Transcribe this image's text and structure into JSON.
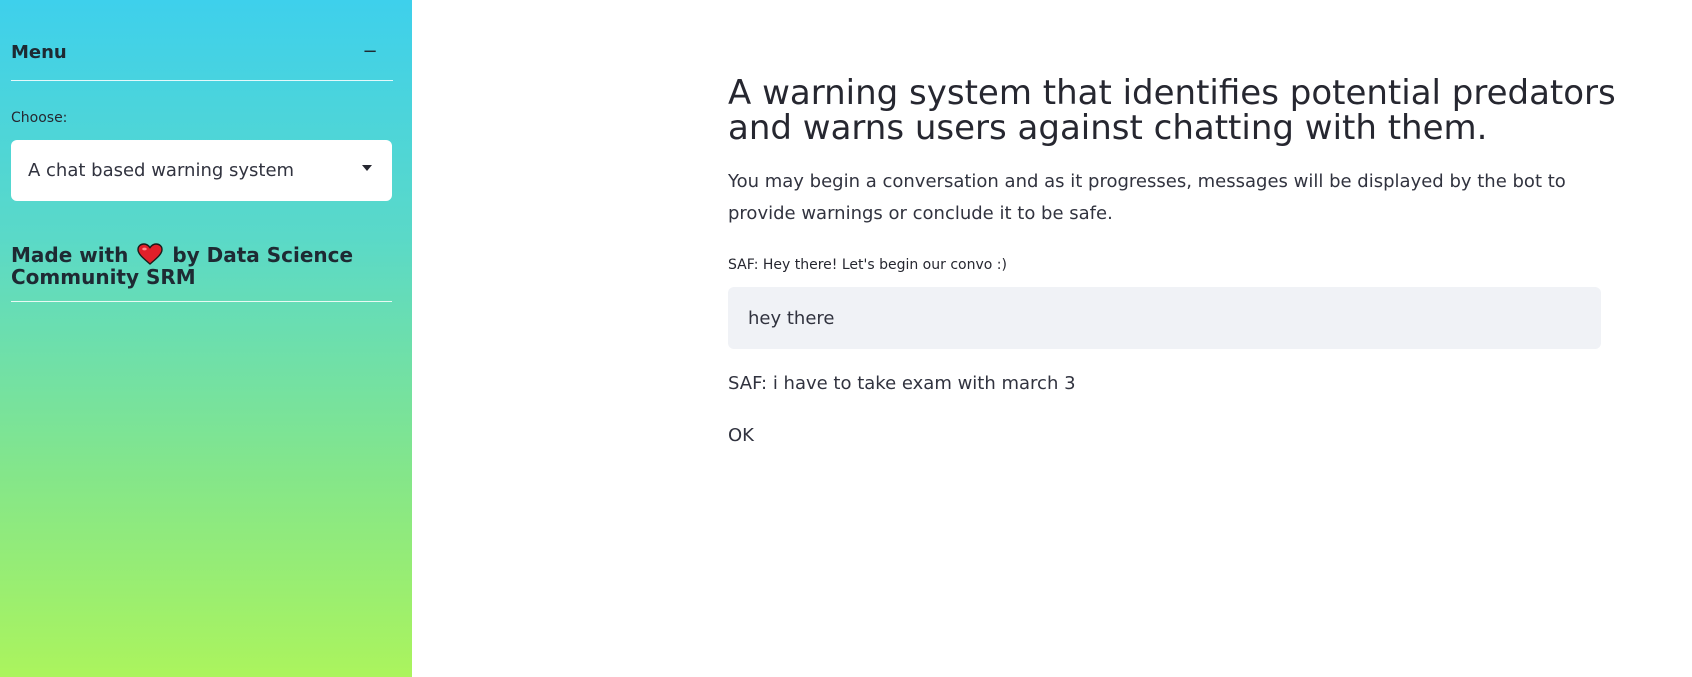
{
  "sidebar": {
    "menu_title": "Menu",
    "collapse_symbol": "−",
    "choose_label": "Choose:",
    "select_value": "A chat based warning system",
    "made_with_prefix": "Made with",
    "made_with_icon": "heart-icon",
    "made_with_suffix": "by Data Science Community SRM",
    "gradient_top": "#3ed0ec",
    "gradient_bottom": "#abf45d"
  },
  "main": {
    "title": "A warning system that identifies potential predators and warns users against chatting with them.",
    "description": "You may begin a conversation and as it progresses, messages will be displayed by the bot to provide warnings or conclude it to be safe.",
    "input_label": "SAF: Hey there! Let's begin our convo :)",
    "input_value": "hey there",
    "bot_message": "SAF: i have to take exam with march 3",
    "status_text": "OK"
  }
}
